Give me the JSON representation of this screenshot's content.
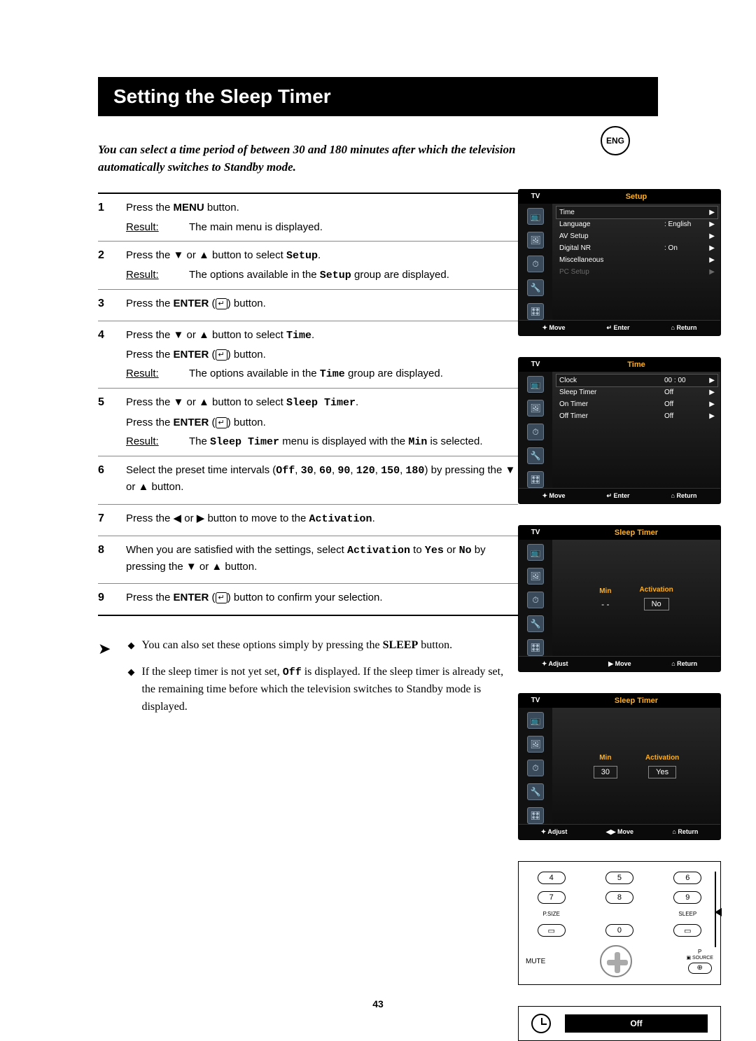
{
  "lang_badge": "ENG",
  "title": "Setting the Sleep Timer",
  "intro": "You can select a time period of between 30 and 180 minutes after which the television automatically switches to Standby mode.",
  "steps": [
    {
      "n": "1",
      "lines": [
        "Press the <b>MENU</b> button."
      ],
      "result": "The main menu is displayed."
    },
    {
      "n": "2",
      "lines": [
        "Press the ▼ or ▲ button to select <span class='mono'>Setup</span>."
      ],
      "result": "The options available in the <span class='mono'>Setup</span> group are displayed."
    },
    {
      "n": "3",
      "lines": [
        "Press the <b>ENTER</b> (<span class='enter-glyph'>↵</span>) button."
      ]
    },
    {
      "n": "4",
      "lines": [
        "Press the ▼ or ▲ button to select <span class='mono'>Time</span>.",
        "Press the <b>ENTER</b> (<span class='enter-glyph'>↵</span>) button."
      ],
      "result": "The options available in the <span class='mono'>Time</span> group are displayed."
    },
    {
      "n": "5",
      "lines": [
        "Press the ▼ or ▲ button to select <span class='mono'>Sleep&nbsp;Timer</span>.",
        "Press the <b>ENTER</b> (<span class='enter-glyph'>↵</span>) button."
      ],
      "result": "The <span class='mono'>Sleep&nbsp;Timer</span> menu is displayed with the <span class='mono'>Min</span> is selected."
    },
    {
      "n": "6",
      "lines": [
        "Select the preset time intervals (<span class='mono'>Off</span>, <span class='mono'>30</span>, <span class='mono'>60</span>, <span class='mono'>90</span>, <span class='mono'>120</span>, <span class='mono'>150</span>, <span class='mono'>180</span>) by pressing the ▼ or ▲ button."
      ]
    },
    {
      "n": "7",
      "lines": [
        "Press the ◀ or ▶ button to move to the <span class='mono'>Activation</span>."
      ]
    },
    {
      "n": "8",
      "lines": [
        "When you are satisfied with the settings, select <span class='mono'>Activation</span> to <span class='mono'>Yes</span> or <span class='mono'>No</span> by pressing the ▼ or ▲ button."
      ]
    },
    {
      "n": "9",
      "lines": [
        "Press the <b>ENTER</b> (<span class='enter-glyph'>↵</span>) button to confirm your selection."
      ]
    }
  ],
  "tips": [
    "You can also set these options simply by pressing the <b>SLEEP</b> button.",
    "If the sleep timer is not yet set, <span class='mono'>Off</span> is displayed. If the sleep timer is already set, the remaining time before which the television switches to Standby mode is displayed."
  ],
  "osd_setup": {
    "tv": "TV",
    "title": "Setup",
    "rows": [
      {
        "label": "Time",
        "val": "",
        "arr": "▶",
        "sel": true
      },
      {
        "label": "Language",
        "val": ": English",
        "arr": "▶"
      },
      {
        "label": "AV Setup",
        "val": "",
        "arr": "▶"
      },
      {
        "label": "Digital NR",
        "val": ": On",
        "arr": "▶"
      },
      {
        "label": "Miscellaneous",
        "val": "",
        "arr": "▶"
      },
      {
        "label": "PC Setup",
        "val": "",
        "arr": "▶",
        "dim": true
      }
    ],
    "footer": [
      "✦ Move",
      "↵ Enter",
      "⌂ Return"
    ]
  },
  "osd_time": {
    "tv": "TV",
    "title": "Time",
    "rows": [
      {
        "label": "Clock",
        "val": "00 : 00",
        "arr": "▶",
        "sel": true
      },
      {
        "label": "Sleep Timer",
        "val": "Off",
        "arr": "▶"
      },
      {
        "label": "On Timer",
        "val": "Off",
        "arr": "▶"
      },
      {
        "label": "Off Timer",
        "val": "Off",
        "arr": "▶"
      }
    ],
    "footer": [
      "✦ Move",
      "↵ Enter",
      "⌂ Return"
    ]
  },
  "osd_sleep1": {
    "tv": "TV",
    "title": "Sleep Timer",
    "min_label": "Min",
    "act_label": "Activation",
    "min_val": "- -",
    "act_val": "No",
    "act_boxed": true,
    "min_boxed": false,
    "footer": [
      "✦ Adjust",
      "▶ Move",
      "⌂ Return"
    ]
  },
  "osd_sleep2": {
    "tv": "TV",
    "title": "Sleep Timer",
    "min_label": "Min",
    "act_label": "Activation",
    "min_val": "30",
    "act_val": "Yes",
    "act_boxed": true,
    "min_boxed": true,
    "footer": [
      "✦ Adjust",
      "◀▶ Move",
      "⌂ Return"
    ]
  },
  "remote": {
    "nums": [
      "4",
      "5",
      "6",
      "7",
      "8",
      "9"
    ],
    "psize": "P.SIZE",
    "sleep": "SLEEP",
    "zero": "0",
    "mute": "MUTE",
    "p": "P",
    "source": "SOURCE"
  },
  "off_panel": {
    "label": "Off"
  },
  "icons": [
    "📺",
    "🖼",
    "⏱",
    "🔧",
    "🎛"
  ],
  "page_number": "43"
}
